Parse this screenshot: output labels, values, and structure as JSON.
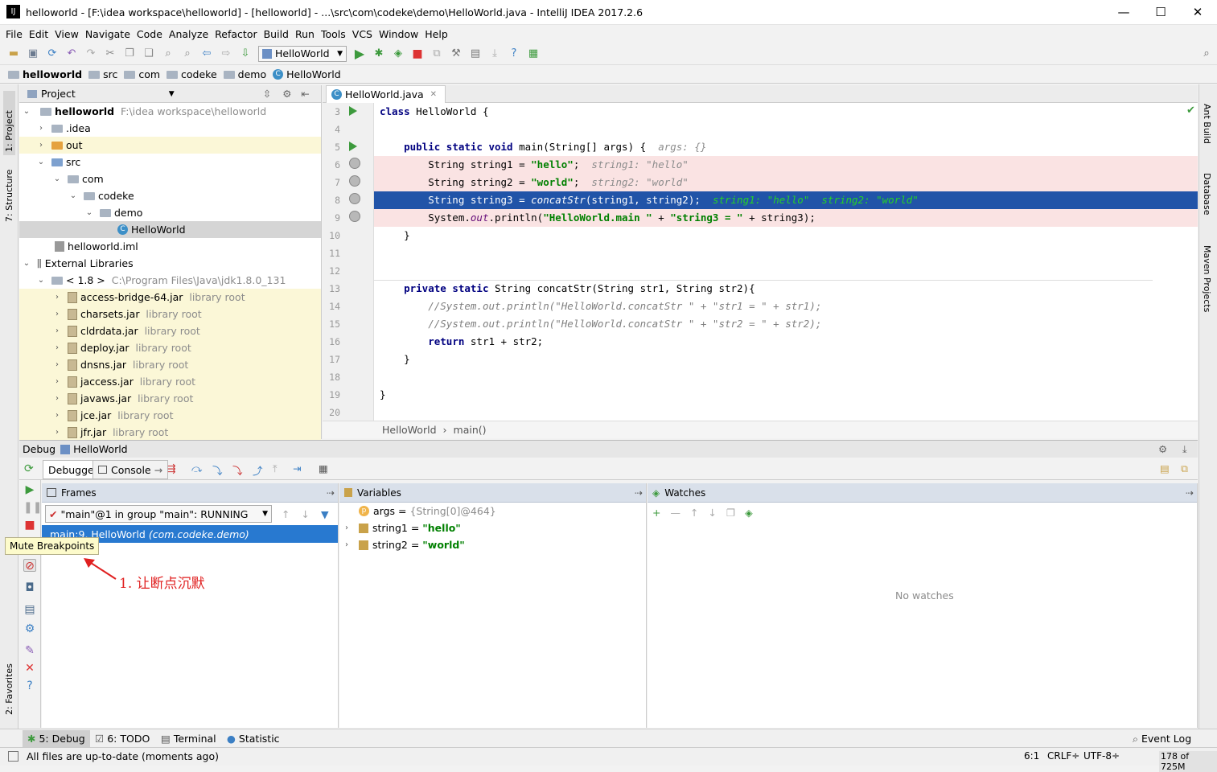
{
  "window": {
    "title": "helloworld - [F:\\idea workspace\\helloworld] - [helloworld] - ...\\src\\com\\codeke\\demo\\HelloWorld.java - IntelliJ IDEA 2017.2.6",
    "minimize": "—",
    "maximize": "☐",
    "close": "✕"
  },
  "menu": [
    "File",
    "Edit",
    "View",
    "Navigate",
    "Code",
    "Analyze",
    "Refactor",
    "Build",
    "Run",
    "Tools",
    "VCS",
    "Window",
    "Help"
  ],
  "toolbar": {
    "run_config": "HelloWorld"
  },
  "nav": [
    "helloworld",
    "src",
    "com",
    "codeke",
    "demo",
    "HelloWorld"
  ],
  "side_left": {
    "project": "1: Project",
    "structure": "7: Structure",
    "favorites": "2: Favorites"
  },
  "side_right": {
    "ant": "Ant Build",
    "database": "Database",
    "maven": "Maven Projects"
  },
  "project": {
    "header": "Project",
    "root": {
      "name": "helloworld",
      "path": "F:\\idea workspace\\helloworld"
    },
    "items": [
      ".idea",
      "out",
      "src",
      "com",
      "codeke",
      "demo",
      "HelloWorld",
      "helloworld.iml",
      "External Libraries"
    ],
    "jdk": {
      "name": "< 1.8 >",
      "path": "C:\\Program Files\\Java\\jdk1.8.0_131"
    },
    "jars": [
      {
        "name": "access-bridge-64.jar",
        "tag": "library root"
      },
      {
        "name": "charsets.jar",
        "tag": "library root"
      },
      {
        "name": "cldrdata.jar",
        "tag": "library root"
      },
      {
        "name": "deploy.jar",
        "tag": "library root"
      },
      {
        "name": "dnsns.jar",
        "tag": "library root"
      },
      {
        "name": "jaccess.jar",
        "tag": "library root"
      },
      {
        "name": "javaws.jar",
        "tag": "library root"
      },
      {
        "name": "jce.jar",
        "tag": "library root"
      },
      {
        "name": "jfr.jar",
        "tag": "library root"
      }
    ]
  },
  "editor": {
    "tab": "HelloWorld.java",
    "lines": [
      "3",
      "4",
      "5",
      "6",
      "7",
      "8",
      "9",
      "10",
      "11",
      "12",
      "13",
      "14",
      "15",
      "16",
      "17",
      "18",
      "19",
      "20"
    ],
    "breadcrumb": {
      "cls": "HelloWorld",
      "method": "main()"
    }
  },
  "debug": {
    "title": "Debug",
    "config": "HelloWorld",
    "tab_debugger": "Debugger",
    "tab_console": "Console",
    "frames_header": "Frames",
    "thread": "\"main\"@1 in group \"main\": RUNNING",
    "frame": {
      "method": "main:9, HelloWorld",
      "pkg": "(com.codeke.demo)"
    },
    "variables_header": "Variables",
    "vars": [
      {
        "name": "args",
        "value": "{String[0]@464}"
      },
      {
        "name": "string1",
        "value": "\"hello\""
      },
      {
        "name": "string2",
        "value": "\"world\""
      }
    ],
    "watches_header": "Watches",
    "no_watches": "No watches",
    "tooltip": "Mute Breakpoints",
    "annotation": "1. 让断点沉默"
  },
  "toolwindows": {
    "debug": "5: Debug",
    "todo": "6: TODO",
    "terminal": "Terminal",
    "statistic": "Statistic",
    "eventlog": "Event Log"
  },
  "status": {
    "message": "All files are up-to-date (moments ago)",
    "pos": "6:1",
    "crlf": "CRLF÷",
    "enc": "UTF-8÷",
    "mem": "178 of 725M"
  }
}
